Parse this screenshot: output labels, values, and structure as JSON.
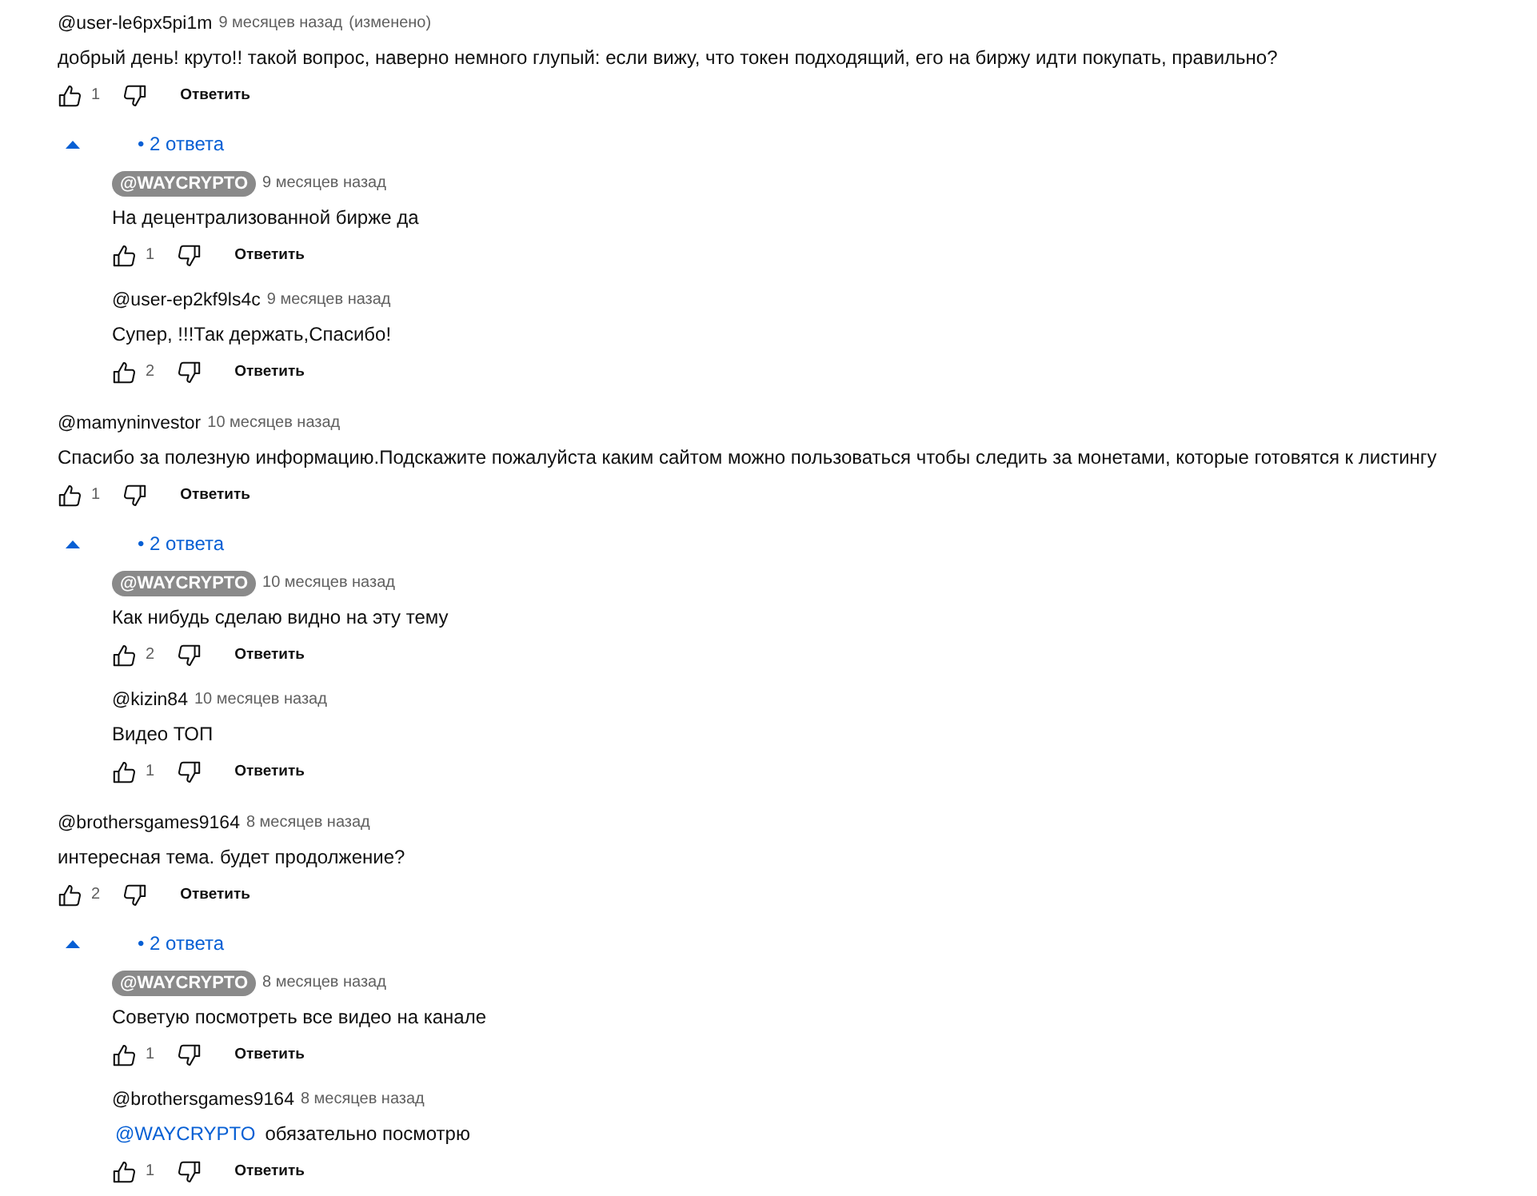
{
  "comments": [
    {
      "author": "@user-le6px5pi1m",
      "owner": false,
      "time": "9 месяцев назад",
      "edited": "(изменено)",
      "text": "добрый день! круто!! такой вопрос, наверно немного глупый: если вижу, что токен подходящий, его на биржу идти покупать, правильно?",
      "likes": "1",
      "reply_label": "Ответить",
      "replies_toggle": {
        "expanded": true,
        "label": "• 2 ответа"
      },
      "replies": [
        {
          "author": "@WAYCRYPTO",
          "owner": true,
          "time": "9 месяцев назад",
          "text": "На децентрализованной бирже да",
          "likes": "1",
          "reply_label": "Ответить"
        },
        {
          "author": "@user-ep2kf9ls4c",
          "owner": false,
          "time": "9 месяцев назад",
          "text": "Супер, !!!Так держать,Спасибо!",
          "likes": "2",
          "reply_label": "Ответить"
        }
      ]
    },
    {
      "author": "@mamyninvestor",
      "owner": false,
      "time": "10 месяцев назад",
      "text": "Спасибо за полезную информацию.Подскажите пожалуйста каким сайтом можно пользоваться чтобы следить за монетами, которые готовятся к листингу",
      "likes": "1",
      "reply_label": "Ответить",
      "replies_toggle": {
        "expanded": true,
        "label": "• 2 ответа"
      },
      "replies": [
        {
          "author": "@WAYCRYPTO",
          "owner": true,
          "time": "10 месяцев назад",
          "text": "Как нибудь сделаю видно на эту тему",
          "likes": "2",
          "reply_label": "Ответить"
        },
        {
          "author": "@kizin84",
          "owner": false,
          "time": "10 месяцев назад",
          "text": "Видео ТОП",
          "likes": "1",
          "reply_label": "Ответить"
        }
      ]
    },
    {
      "author": "@brothersgames9164",
      "owner": false,
      "time": "8 месяцев назад",
      "text": "интересная тема. будет продолжение?",
      "likes": "2",
      "reply_label": "Ответить",
      "replies_toggle": {
        "expanded": true,
        "label": "• 2 ответа"
      },
      "replies": [
        {
          "author": "@WAYCRYPTO",
          "owner": true,
          "time": "8 месяцев назад",
          "text": "Советую посмотреть все видео на канале",
          "likes": "1",
          "reply_label": "Ответить"
        },
        {
          "author": "@brothersgames9164",
          "owner": false,
          "time": "8 месяцев назад",
          "mention": "@WAYCRYPTO",
          "text": "обязательно посмотрю",
          "likes": "1",
          "reply_label": "Ответить"
        }
      ]
    }
  ]
}
